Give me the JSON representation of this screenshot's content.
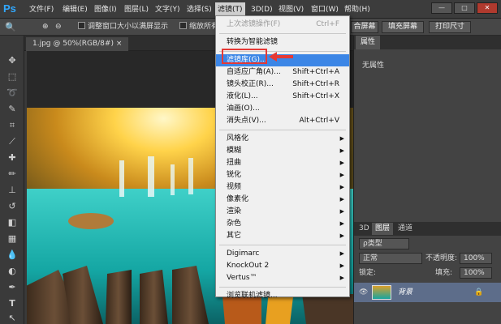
{
  "app": {
    "logo": "Ps"
  },
  "menubar": {
    "items": [
      "文件(F)",
      "编辑(E)",
      "图像(I)",
      "图层(L)",
      "文字(Y)",
      "选择(S)",
      "滤镜(T)",
      "3D(D)",
      "视图(V)",
      "窗口(W)",
      "帮助(H)"
    ],
    "active": "滤镜(T)",
    "window_buttons": [
      "—",
      "□",
      "✕"
    ]
  },
  "options": {
    "zoom_icon": "zoom-icon",
    "checkbox1": "调整窗口大小以满屏显示",
    "checkbox2": "缩放所有",
    "btn_fit": "合屏幕",
    "btn_fill": "填充屏幕",
    "btn_print": "打印尺寸"
  },
  "document": {
    "tab": "1.jpg @ 50%(RGB/8#)",
    "tab_close": "×"
  },
  "properties": {
    "tab": "属性",
    "content": "无属性"
  },
  "layers": {
    "tabs": [
      "3D",
      "图层",
      "通道"
    ],
    "filter_kind": "ρ类型",
    "blend_mode": "正常",
    "opacity_label": "不透明度:",
    "opacity": "100%",
    "lock_label": "锁定:",
    "fill_label": "填充:",
    "fill": "100%",
    "layer_name": "背景"
  },
  "filter_menu": {
    "items": [
      {
        "label": "上次滤镜操作(F)",
        "shortcut": "Ctrl+F",
        "disabled": true
      },
      {
        "sep": true
      },
      {
        "label": "转换为智能滤镜",
        "shortcut": ""
      },
      {
        "sep": true
      },
      {
        "label": "滤镜库(G)...",
        "shortcut": "",
        "highlight": true
      },
      {
        "label": "自适应广角(A)...",
        "shortcut": "Shift+Ctrl+A"
      },
      {
        "label": "镜头校正(R)...",
        "shortcut": "Shift+Ctrl+R"
      },
      {
        "label": "液化(L)...",
        "shortcut": "Shift+Ctrl+X"
      },
      {
        "label": "油画(O)...",
        "shortcut": ""
      },
      {
        "label": "消失点(V)...",
        "shortcut": "Alt+Ctrl+V"
      },
      {
        "sep": true
      },
      {
        "label": "风格化",
        "submenu": true
      },
      {
        "label": "模糊",
        "submenu": true
      },
      {
        "label": "扭曲",
        "submenu": true
      },
      {
        "label": "锐化",
        "submenu": true
      },
      {
        "label": "视频",
        "submenu": true
      },
      {
        "label": "像素化",
        "submenu": true
      },
      {
        "label": "渲染",
        "submenu": true
      },
      {
        "label": "杂色",
        "submenu": true
      },
      {
        "label": "其它",
        "submenu": true
      },
      {
        "sep": true
      },
      {
        "label": "Digimarc",
        "submenu": true
      },
      {
        "label": "KnockOut 2",
        "submenu": true
      },
      {
        "label": "Vertus™",
        "submenu": true
      },
      {
        "sep": true
      },
      {
        "label": "浏览联机滤镜...",
        "shortcut": ""
      }
    ]
  },
  "colors": {
    "highlight": "#3c86e6",
    "annotation": "#e53935",
    "ps_blue": "#31a8ff"
  }
}
